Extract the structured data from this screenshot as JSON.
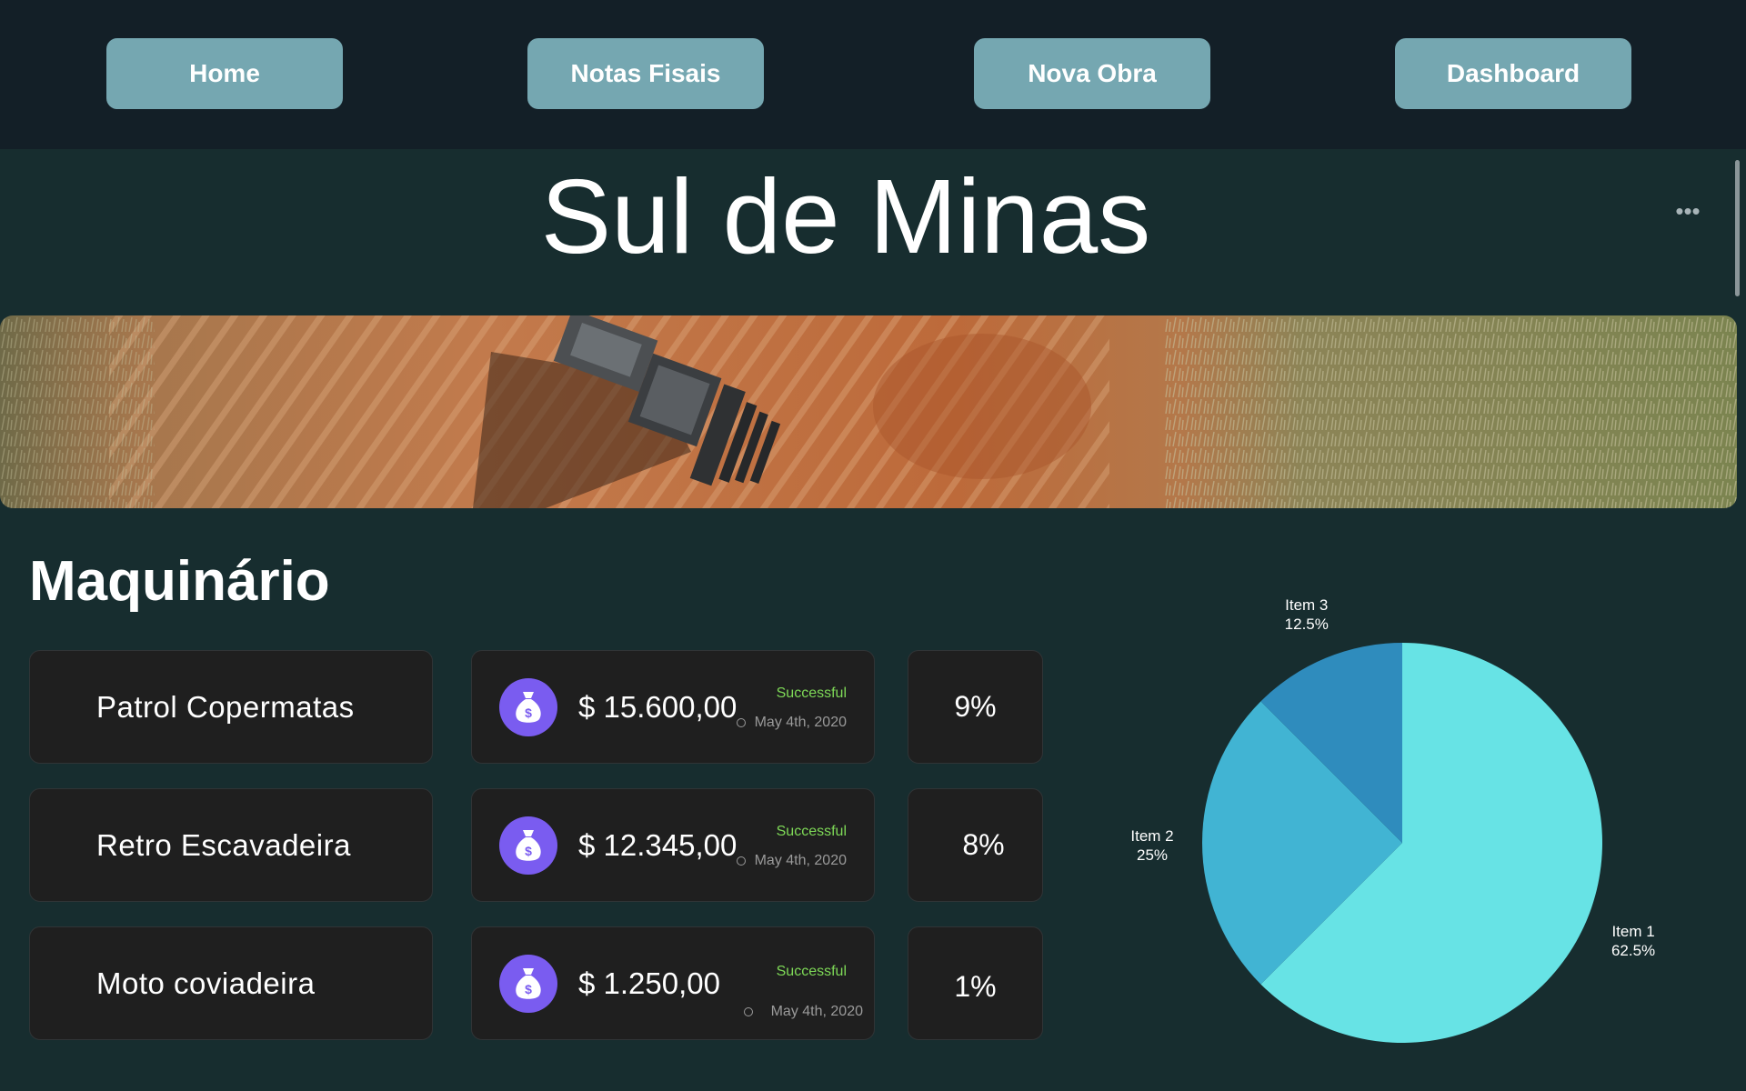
{
  "nav": {
    "home": "Home",
    "notas": "Notas Fisais",
    "nova_obra": "Nova Obra",
    "dashboard": "Dashboard"
  },
  "page_title": "Sul de Minas",
  "section_title": "Maquinário",
  "machines": [
    {
      "name": "Patrol Copermatas",
      "amount": "$ 15.600,00",
      "status": "Successful",
      "date": "May 4th, 2020",
      "pct": "9%"
    },
    {
      "name": "Retro Escavadeira",
      "amount": "$ 12.345,00",
      "status": "Successful",
      "date": "May 4th, 2020",
      "pct": "8%"
    },
    {
      "name": "Moto coviadeira",
      "amount": "$ 1.250,00",
      "status": "Successful",
      "date": "May 4th, 2020",
      "pct": "1%"
    }
  ],
  "colors": {
    "accent_button": "#75a7b1",
    "status_success": "#7ed957",
    "money_icon_bg": "#7a5cf0"
  },
  "icons": {
    "more": "more-horizontal-icon",
    "money": "money-bag-icon",
    "clock": "clock-icon"
  },
  "chart_data": {
    "type": "pie",
    "slices": [
      {
        "label": "Item 1",
        "value": 62.5,
        "display": "62.5%",
        "color": "#67e3e5"
      },
      {
        "label": "Item 2",
        "value": 25,
        "display": "25%",
        "color": "#41b4d3"
      },
      {
        "label": "Item 3",
        "value": 12.5,
        "display": "12.5%",
        "color": "#2f8cbd"
      }
    ]
  }
}
